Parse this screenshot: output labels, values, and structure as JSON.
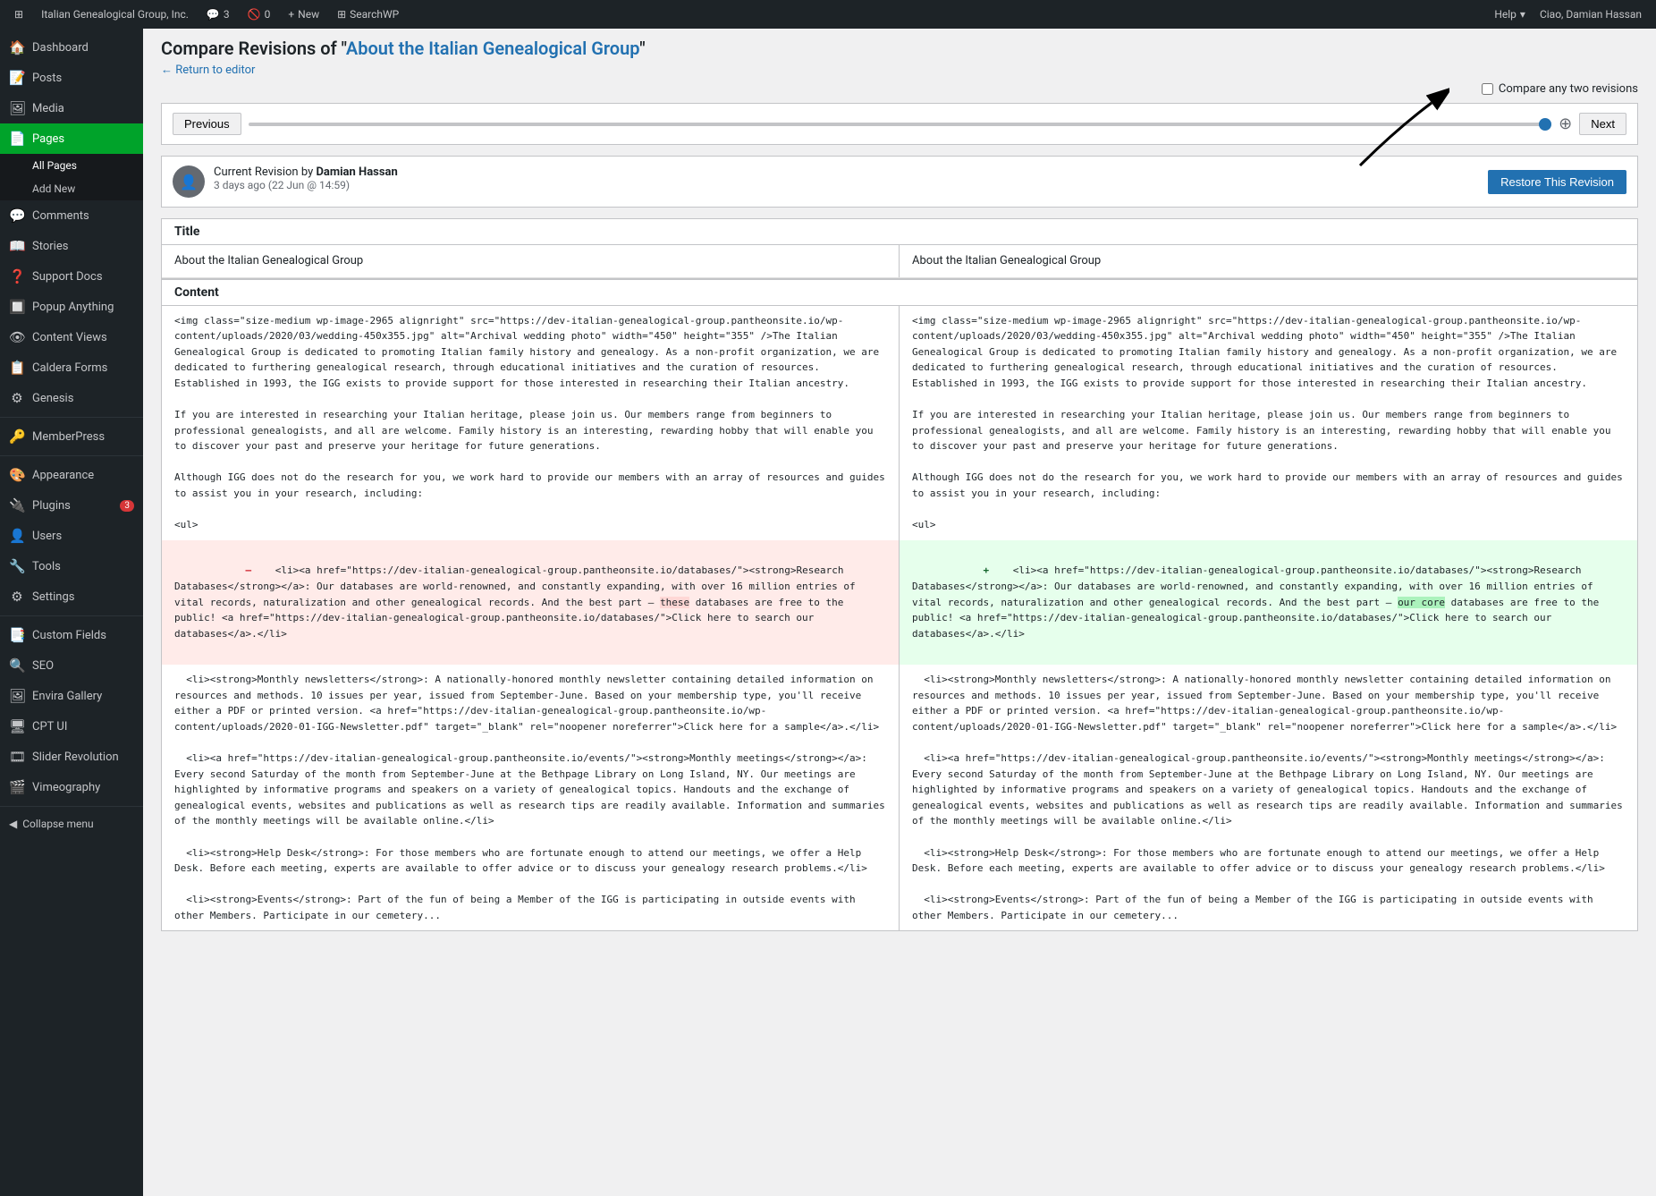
{
  "adminbar": {
    "wp_icon": "⊞",
    "site_name": "Italian Genealogical Group, Inc.",
    "comments_count": "3",
    "comments_icon": "💬",
    "spam_count": "0",
    "spam_icon": "🚫",
    "new_label": "New",
    "searchwp_label": "SearchWP",
    "help_label": "Help",
    "user_greeting": "Ciao, Damian Hassan"
  },
  "sidebar": {
    "items": [
      {
        "icon": "🏠",
        "label": "Dashboard",
        "name": "dashboard"
      },
      {
        "icon": "📝",
        "label": "Posts",
        "name": "posts"
      },
      {
        "icon": "🖼",
        "label": "Media",
        "name": "media"
      },
      {
        "icon": "📄",
        "label": "Pages",
        "name": "pages",
        "active": true
      },
      {
        "icon": "💬",
        "label": "Comments",
        "name": "comments"
      },
      {
        "icon": "📖",
        "label": "Stories",
        "name": "stories"
      },
      {
        "icon": "❓",
        "label": "Support Docs",
        "name": "support-docs"
      },
      {
        "icon": "🔲",
        "label": "Popup Anything",
        "name": "popup-anything"
      },
      {
        "icon": "👁",
        "label": "Content Views",
        "name": "content-views"
      },
      {
        "icon": "📋",
        "label": "Caldera Forms",
        "name": "caldera-forms"
      },
      {
        "icon": "⚙",
        "label": "Genesis",
        "name": "genesis"
      },
      {
        "icon": "🔑",
        "label": "MemberPress",
        "name": "memberpress"
      },
      {
        "icon": "🎨",
        "label": "Appearance",
        "name": "appearance"
      },
      {
        "icon": "🔌",
        "label": "Plugins",
        "name": "plugins",
        "badge": "3"
      },
      {
        "icon": "👤",
        "label": "Users",
        "name": "users"
      },
      {
        "icon": "🔧",
        "label": "Tools",
        "name": "tools"
      },
      {
        "icon": "⚙",
        "label": "Settings",
        "name": "settings"
      },
      {
        "icon": "📑",
        "label": "Custom Fields",
        "name": "custom-fields"
      },
      {
        "icon": "🔍",
        "label": "SEO",
        "name": "seo"
      },
      {
        "icon": "🖼",
        "label": "Envira Gallery",
        "name": "envira-gallery"
      },
      {
        "icon": "🖥",
        "label": "CPT UI",
        "name": "cpt-ui"
      },
      {
        "icon": "🎞",
        "label": "Slider Revolution",
        "name": "slider-revolution"
      },
      {
        "icon": "🎬",
        "label": "Vimeography",
        "name": "vimeography"
      }
    ],
    "pages_submenu": [
      {
        "label": "All Pages",
        "active": false
      },
      {
        "label": "Add New",
        "active": false
      }
    ],
    "collapse_label": "Collapse menu"
  },
  "page": {
    "title_prefix": "Compare Revisions of \"",
    "page_link_text": "About the Italian Genealogical Group",
    "title_suffix": "\"",
    "return_link": "← Return to editor",
    "compare_any_label": "Compare any two revisions",
    "prev_label": "Previous",
    "next_label": "Next",
    "revision_info": {
      "author_label": "Current Revision by",
      "author": "Damian Hassan",
      "date": "3 days ago (22 Jun @ 14:59)"
    },
    "restore_btn": "Restore This Revision",
    "diff": {
      "title_label": "Title",
      "left_title": "About the Italian Genealogical Group",
      "right_title": "About the Italian Genealogical Group",
      "content_label": "Content",
      "left_content_intro": "<img class=\"size-medium wp-image-2965 alignright\" src=\"https://dev-italian-genealogical-group.pantheonsite.io/wp-content/uploads/2020/03/wedding-450x355.jpg\" alt=\"Archival wedding photo\" width=\"450\" height=\"355\" />The Italian Genealogical Group is dedicated to promoting Italian family history and genealogy. As a non-profit organization, we are dedicated to furthering genealogical research, through educational initiatives and the curation of resources. Established in 1993, the IGG exists to provide support for those interested in researching their Italian ancestry.\n\nIf you are interested in researching your Italian heritage, please join us. Our members range from beginners to professional genealogists, and all are welcome. Family history is an interesting, rewarding hobby that will enable you to discover your past and preserve your heritage for future generations.\n\nAlthough IGG does not do the research for you, we work hard to provide our members with an array of resources and guides to assist you in your research, including:\n\n<ul>",
      "right_content_intro": "<img class=\"size-medium wp-image-2965 alignright\" src=\"https://dev-italian-genealogical-group.pantheonsite.io/wp-content/uploads/2020/03/wedding-450x355.jpg\" alt=\"Archival wedding photo\" width=\"450\" height=\"355\" />The Italian Genealogical Group is dedicated to promoting Italian family history and genealogy. As a non-profit organization, we are dedicated to furthering genealogical research, through educational initiatives and the curation of resources. Established in 1993, the IGG exists to provide support for those interested in researching their Italian ancestry.\n\nIf you are interested in researching your Italian heritage, please join us. Our members range from beginners to professional genealogists, and all are welcome. Family history is an interesting, rewarding hobby that will enable you to discover your past and preserve your heritage for future generations.\n\nAlthough IGG does not do the research for you, we work hard to provide our members with an array of resources and guides to assist you in your research, including:\n\n<ul>",
      "left_removed_line": "  <li><a href=\"https://dev-italian-genealogical-group.pantheonsite.io/databases/\"><strong>Research Databases</strong></a>: Our databases are world-renowned, and constantly expanding, with over 16 million entries of vital records, naturalization and other genealogical records. And the best part – these databases are free to the public! <a href=\"https://dev-italian-genealogical-group.pantheonsite.io/databases/\">Click here to search our databases</a>.</li>",
      "right_added_line": "  <li><a href=\"https://dev-italian-genealogical-group.pantheonsite.io/databases/\"><strong>Research Databases</strong></a>: Our databases are world-renowned, and constantly expanding, with over 16 million entries of vital records, naturalization and other genealogical records. And the best part – our core databases are free to the public! <a href=\"https://dev-italian-genealogical-group.pantheonsite.io/databases/\">Click here to search our databases</a>.</li>",
      "removed_highlight": "these",
      "added_highlight": "our core",
      "after_list": "  <li><strong>Monthly newsletters</strong>: A nationally-honored monthly newsletter containing detailed information on resources and methods. 10 issues per year, issued from September-June. Based on your membership type, you'll receive either a PDF or printed version. <a href=\"https://dev-italian-genealogical-group.pantheonsite.io/wp-content/uploads/2020/01-IGG-Newsletter.pdf\" target=\"_blank\" rel=\"noopener noreferrer\">Click here for a sample</a>.</li>\n\n  <li><a href=\"https://dev-italian-genealogical-group.pantheonsite.io/events/\"><strong>Monthly meetings</strong></a>: Every second Saturday of the month from September-June at the Bethpage Library on Long Island, NY. Our meetings are highlighted by informative programs and speakers on a variety of genealogical topics. Handouts and the exchange of genealogical events, websites and publications as well as research tips are readily available. Information and summaries of the monthly meetings will be available online.</li>\n\n  <li><strong>Help Desk</strong>: For those members who are fortunate enough to attend our meetings, we offer a Help Desk. Before each meeting, experts are available to offer advice or to discuss your genealogy research problems.</li>\n\n  <li><strong>Events</strong>: Part of the fun of being a Member of the IGG is participating in outside events with other Members. Participate in our cemetery..."
    }
  }
}
